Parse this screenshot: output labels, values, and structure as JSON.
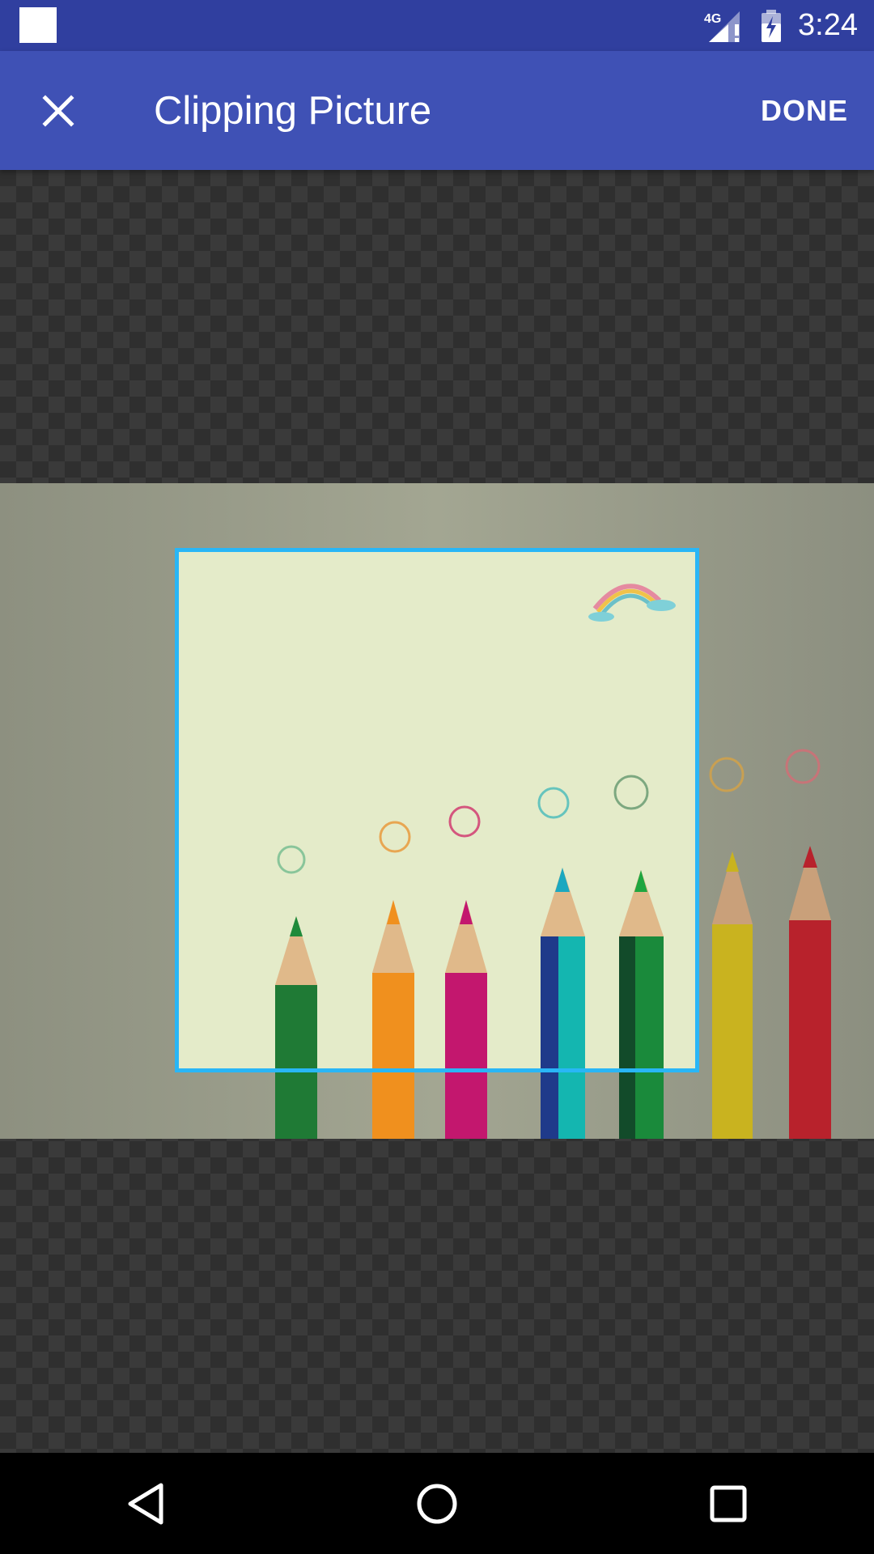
{
  "status_bar": {
    "network_label": "4G",
    "time": "3:24",
    "icons": [
      "notification-square-icon",
      "signal-4g-icon",
      "battery-charging-icon"
    ]
  },
  "app_bar": {
    "title": "Clipping Picture",
    "close_icon": "close-icon",
    "done_label": "DONE",
    "background": "#3f51b5",
    "status_background": "#303f9f"
  },
  "editor": {
    "crop_border_color": "#29b6f6",
    "image_description": "colored-pencils-photo"
  },
  "nav_bar": {
    "icons": [
      "back-icon",
      "home-icon",
      "recents-icon"
    ]
  }
}
